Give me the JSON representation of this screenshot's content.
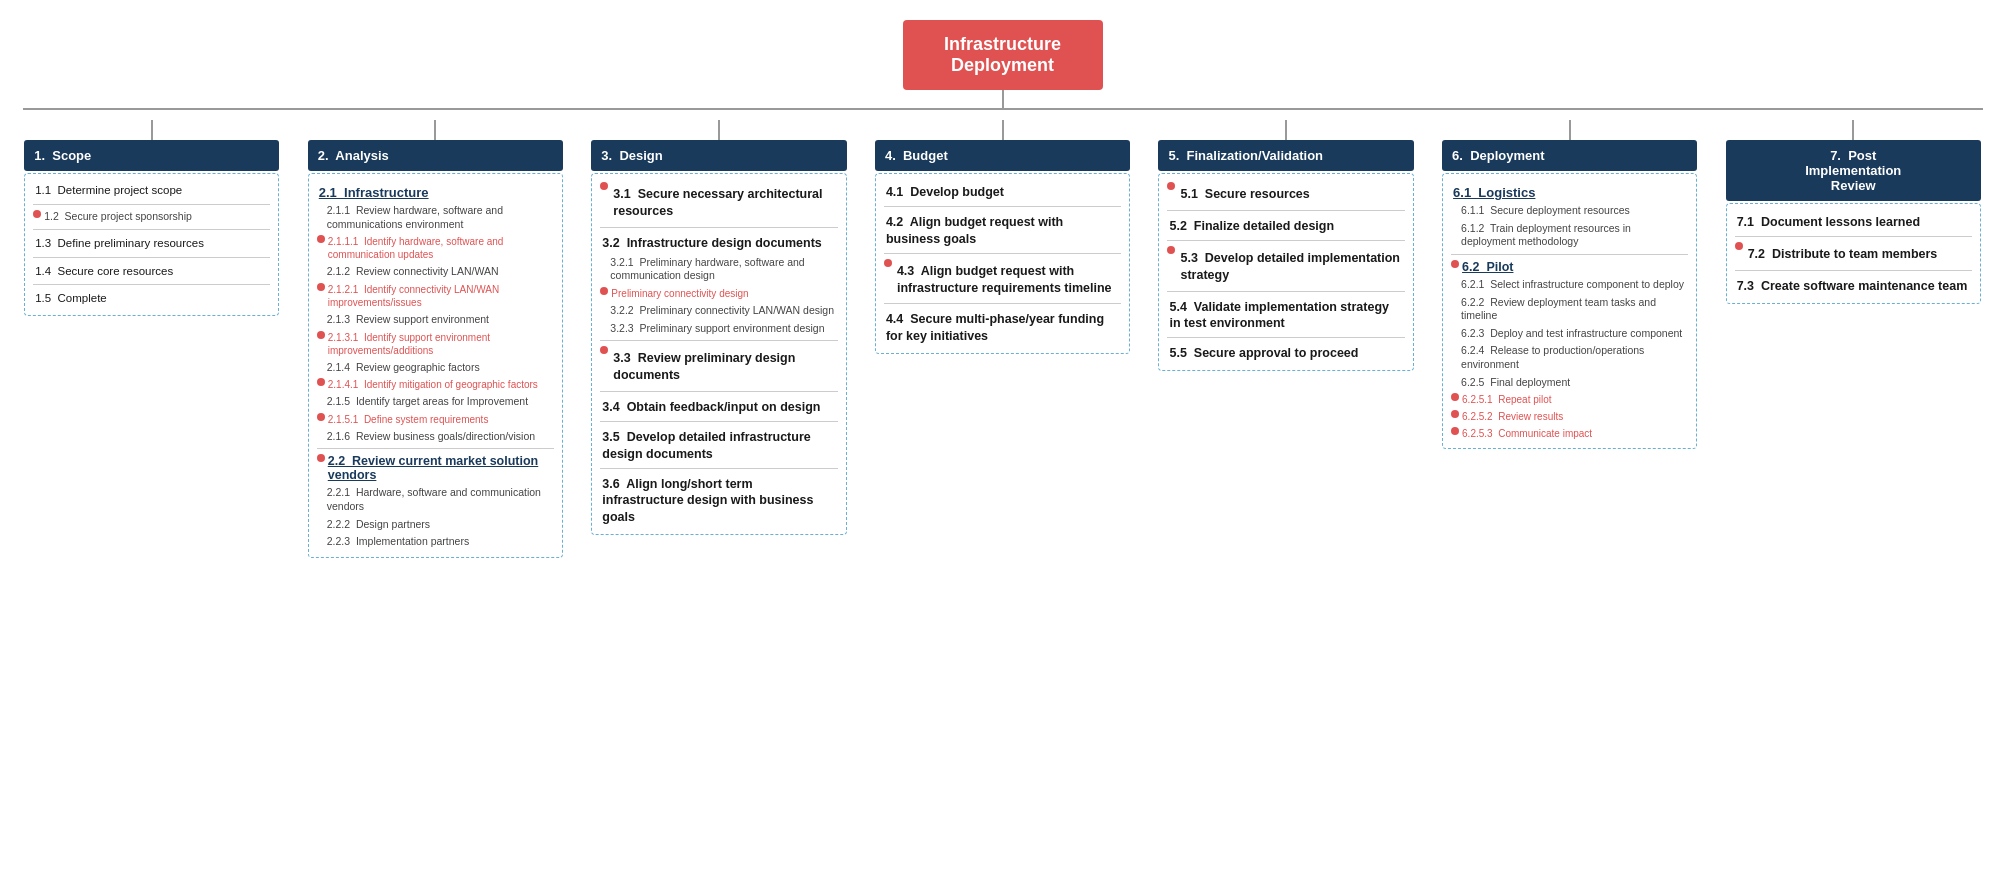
{
  "root": {
    "label": "Infrastructure\nDeployment"
  },
  "columns": [
    {
      "id": "scope",
      "header": "1.  Scope",
      "items": [
        {
          "type": "item",
          "text": "1.1  Determine project scope"
        },
        {
          "type": "item",
          "text": "1.2  Secure project sponsorship"
        },
        {
          "type": "item",
          "text": "1.3  Define preliminary resources"
        },
        {
          "type": "item",
          "text": "1.4  Secure core resources"
        },
        {
          "type": "item",
          "text": "1.5  Complete"
        }
      ]
    },
    {
      "id": "analysis",
      "header": "2.  Analysis",
      "sections": [
        {
          "title": "2.1  Infrastructure",
          "children": [
            {
              "type": "sub",
              "text": "2.1.1  Review hardware, software and communications environment"
            },
            {
              "type": "dot-sub",
              "text": "2.1.1.1  Identify hardware, software and communication updates"
            },
            {
              "type": "sub",
              "text": "2.1.2  Review connectivity LAN/WAN"
            },
            {
              "type": "dot-sub",
              "text": "2.1.2.1  Identify connectivity LAN/WAN improvements/issues"
            },
            {
              "type": "sub",
              "text": "2.1.3  Review support environment"
            },
            {
              "type": "dot-sub",
              "text": "2.1.3.1  Identify support environment improvements/additions"
            },
            {
              "type": "sub",
              "text": "2.1.4  Review geographic factors"
            },
            {
              "type": "dot-sub",
              "text": "2.1.4.1  Identify mitigation of geographic factors"
            },
            {
              "type": "sub",
              "text": "2.1.5  Identify target areas for Improvement"
            },
            {
              "type": "dot-sub",
              "text": "2.1.5.1  Define system requirements"
            },
            {
              "type": "sub",
              "text": "2.1.6  Review business goals/direction/vision"
            }
          ]
        },
        {
          "title": "2.2  Review current market solution vendors",
          "children": [
            {
              "type": "sub",
              "text": "2.2.1  Hardware, software and communication vendors"
            },
            {
              "type": "sub",
              "text": "2.2.2  Design partners"
            },
            {
              "type": "sub",
              "text": "2.2.3  Implementation partners"
            }
          ]
        }
      ]
    },
    {
      "id": "design",
      "header": "3.  Design",
      "items": [
        {
          "type": "item-bold",
          "text": "3.1  Secure necessary architectural resources"
        },
        {
          "type": "item-bold",
          "text": "3.2  Infrastructure design documents"
        },
        {
          "type": "sub",
          "text": "3.2.1  Preliminary hardware, software and communication design"
        },
        {
          "type": "dot-sub",
          "text": "Preliminary connectivity design"
        },
        {
          "type": "sub",
          "text": "3.2.2  Preliminary connectivity LAN/WAN design"
        },
        {
          "type": "sub",
          "text": "3.2.3  Preliminary support environment design"
        },
        {
          "type": "item-bold",
          "text": "3.3  Review preliminary design documents"
        },
        {
          "type": "item-bold",
          "text": "3.4  Obtain feedback/input on design"
        },
        {
          "type": "item-bold",
          "text": "3.5  Develop detailed infrastructure design documents"
        },
        {
          "type": "item-bold",
          "text": "3.6  Align long/short term infrastructure design with business goals"
        }
      ]
    },
    {
      "id": "budget",
      "header": "4.  Budget",
      "items": [
        {
          "type": "item-bold",
          "text": "4.1  Develop budget"
        },
        {
          "type": "item-bold",
          "text": "4.2  Align budget request with business goals"
        },
        {
          "type": "item-bold",
          "text": "4.3  Align budget request with infrastructure requirements timeline"
        },
        {
          "type": "item-bold",
          "text": "4.4  Secure multi-phase/year funding for key initiatives"
        }
      ]
    },
    {
      "id": "finalization",
      "header": "5.  Finalization/Validation",
      "items": [
        {
          "type": "item-bold",
          "text": "5.1  Secure resources"
        },
        {
          "type": "item-bold",
          "text": "5.2  Finalize detailed design"
        },
        {
          "type": "item-bold",
          "text": "5.3  Develop detailed implementation strategy"
        },
        {
          "type": "item-bold",
          "text": "5.4  Validate implementation strategy in test environment"
        },
        {
          "type": "item-bold",
          "text": "5.5  Secure approval to proceed"
        }
      ]
    },
    {
      "id": "deployment",
      "header": "6.  Deployment",
      "sections": [
        {
          "title": "6.1  Logistics",
          "children": [
            {
              "type": "sub",
              "text": "6.1.1  Secure deployment resources"
            },
            {
              "type": "sub",
              "text": "6.1.2  Train deployment resources in deployment methodology"
            }
          ]
        },
        {
          "title": "6.2  Pilot",
          "dot": true,
          "children": [
            {
              "type": "sub",
              "text": "6.2.1  Select infrastructure component to deploy"
            },
            {
              "type": "sub",
              "text": "6.2.2  Review deployment team tasks and timeline"
            },
            {
              "type": "sub",
              "text": "6.2.3  Deploy and test infrastructure component"
            },
            {
              "type": "sub",
              "text": "6.2.4  Release to production/operations environment"
            },
            {
              "type": "sub",
              "text": "6.2.5  Final deployment"
            },
            {
              "type": "dot-sub",
              "text": "6.2.5.1  Repeat pilot"
            },
            {
              "type": "dot-sub",
              "text": "6.2.5.2  Review results"
            },
            {
              "type": "dot-sub",
              "text": "6.2.5.3  Communicate impact"
            }
          ]
        }
      ]
    },
    {
      "id": "post",
      "header": "7.  Post\nImplementation\nReview",
      "items": [
        {
          "type": "item-bold",
          "text": "7.1  Document lessons learned"
        },
        {
          "type": "item-bold",
          "text": "7.2  Distribute to team members"
        },
        {
          "type": "item-bold",
          "text": "7.3  Create software maintenance team"
        }
      ]
    }
  ]
}
